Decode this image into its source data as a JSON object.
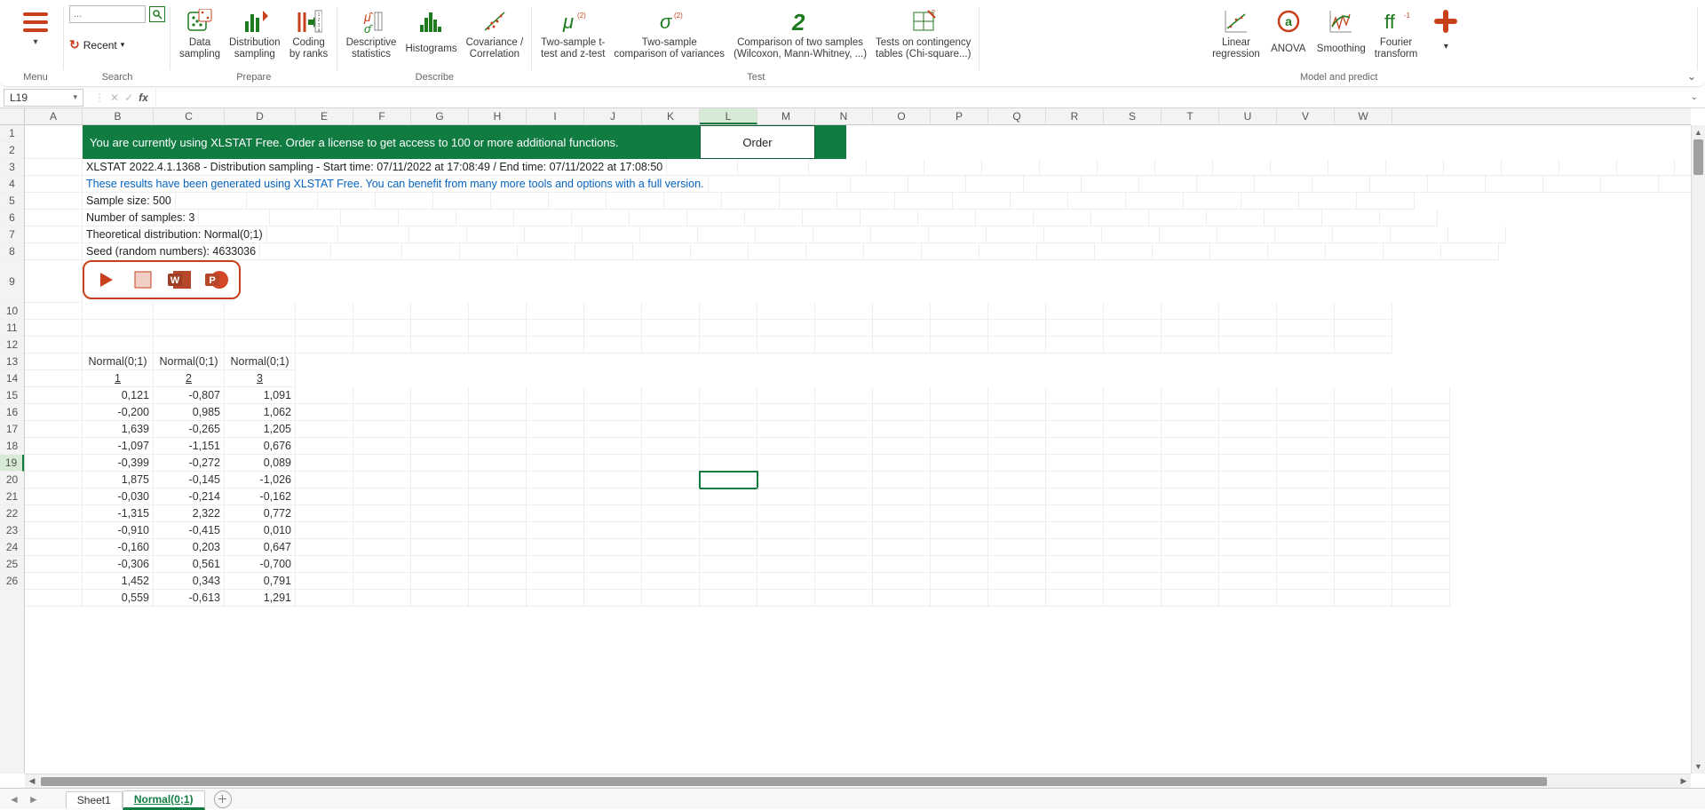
{
  "ribbon": {
    "menu_label": "Menu",
    "search_placeholder": "...",
    "recent_label": "Recent",
    "search_group": "Search",
    "prepare_group": "Prepare",
    "describe_group": "Describe",
    "test_group": "Test",
    "model_group": "Model and predict",
    "buttons": {
      "data_sampling": "Data\nsampling",
      "dist_sampling": "Distribution\nsampling",
      "coding_ranks": "Coding\nby ranks",
      "desc_stats": "Descriptive\nstatistics",
      "histograms": "Histograms",
      "cov_corr": "Covariance /\nCorrelation",
      "ttest": "Two-sample t-\ntest and z-test",
      "var_comp": "Two-sample\ncomparison of variances",
      "two_sample_comp": "Comparison of two samples\n(Wilcoxon, Mann-Whitney, ...)",
      "contingency": "Tests on contingency\ntables (Chi-square...)",
      "lin_reg": "Linear\nregression",
      "anova": "ANOVA",
      "smoothing": "Smoothing",
      "fourier": "Fourier\ntransform"
    }
  },
  "namebox": "L19",
  "columns": [
    "A",
    "B",
    "C",
    "D",
    "E",
    "F",
    "G",
    "H",
    "I",
    "J",
    "K",
    "L",
    "M",
    "N",
    "O",
    "P",
    "Q",
    "R",
    "S",
    "T",
    "U",
    "V",
    "W"
  ],
  "banner": {
    "text": "You are currently using XLSTAT Free. Order a license to get access to 100 or more additional functions.",
    "order": "Order"
  },
  "info": {
    "line3": "XLSTAT 2022.4.1.1368 - Distribution sampling - Start time: 07/11/2022 at 17:08:49 / End time: 07/11/2022 at 17:08:50",
    "line4": "These results have been generated using XLSTAT Free. You can benefit from many more tools and options with a full version.",
    "line5": "Sample size: 500",
    "line6": "Number of samples: 3",
    "line7": "Theoretical distribution: Normal(0;1)",
    "line8": "Seed (random numbers): 4633036"
  },
  "data_header": {
    "top": [
      "Normal(0;1)",
      "Normal(0;1)",
      "Normal(0;1)"
    ],
    "sub": [
      "1",
      "2",
      "3"
    ]
  },
  "data_rows": [
    [
      "0,121",
      "-0,807",
      "1,091"
    ],
    [
      "-0,200",
      "0,985",
      "1,062"
    ],
    [
      "1,639",
      "-0,265",
      "1,205"
    ],
    [
      "-1,097",
      "-1,151",
      "0,676"
    ],
    [
      "-0,399",
      "-0,272",
      "0,089"
    ],
    [
      "1,875",
      "-0,145",
      "-1,026"
    ],
    [
      "-0,030",
      "-0,214",
      "-0,162"
    ],
    [
      "-1,315",
      "2,322",
      "0,772"
    ],
    [
      "-0,910",
      "-0,415",
      "0,010"
    ],
    [
      "-0,160",
      "0,203",
      "0,647"
    ],
    [
      "-0,306",
      "0,561",
      "-0,700"
    ],
    [
      "1,452",
      "0,343",
      "0,791"
    ],
    [
      "0,559",
      "-0,613",
      "1,291"
    ]
  ],
  "sheets": {
    "s1": "Sheet1",
    "s2": "Normal(0;1)"
  },
  "active_cell": {
    "row": 19,
    "col": "L"
  }
}
